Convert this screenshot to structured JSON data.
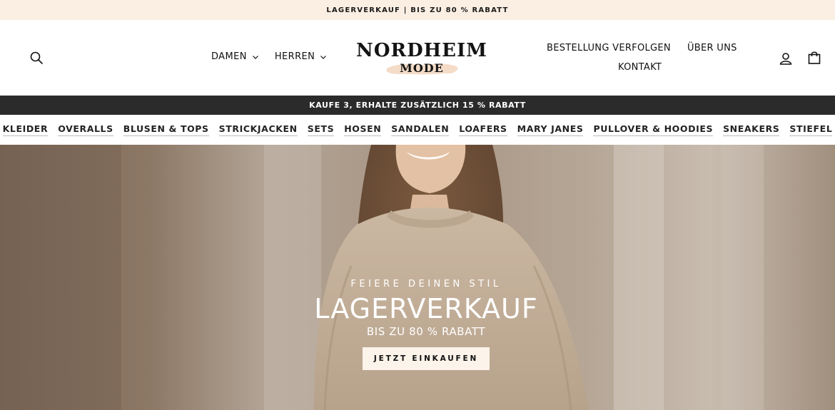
{
  "announcement": "LAGERVERKAUF | BIS ZU 80 % RABATT",
  "header": {
    "nav_left": [
      {
        "label": "DAMEN"
      },
      {
        "label": "HERREN"
      }
    ],
    "logo": {
      "line1": "NORDHEIM",
      "line2": "MODE"
    },
    "nav_right": {
      "track": "BESTELLUNG VERFOLGEN",
      "about": "ÜBER UNS",
      "contact": "KONTAKT"
    },
    "icons": {
      "search": "search-icon",
      "account": "account-icon",
      "cart": "cart-icon"
    }
  },
  "promo_bar": "KAUFE 3, ERHALTE ZUSÄTZLICH 15 % RABATT",
  "categories": [
    "KLEIDER",
    "OVERALLS",
    "BLUSEN & TOPS",
    "STRICKJACKEN",
    "SETS",
    "HOSEN",
    "SANDALEN",
    "LOAFERS",
    "MARY JANES",
    "PULLOVER & HOODIES",
    "SNEAKERS",
    "STIEFEL"
  ],
  "hero": {
    "eyebrow": "FEIERE DEINEN STIL",
    "title": "LAGERVERKAUF",
    "subtitle": "BIS ZU 80 % RABATT",
    "cta": "JETZT EINKAUFEN"
  },
  "colors": {
    "announcement_bg": "#fbefe3",
    "promo_bg": "#2b2b2b",
    "cta_bg": "#fcf3ea"
  }
}
